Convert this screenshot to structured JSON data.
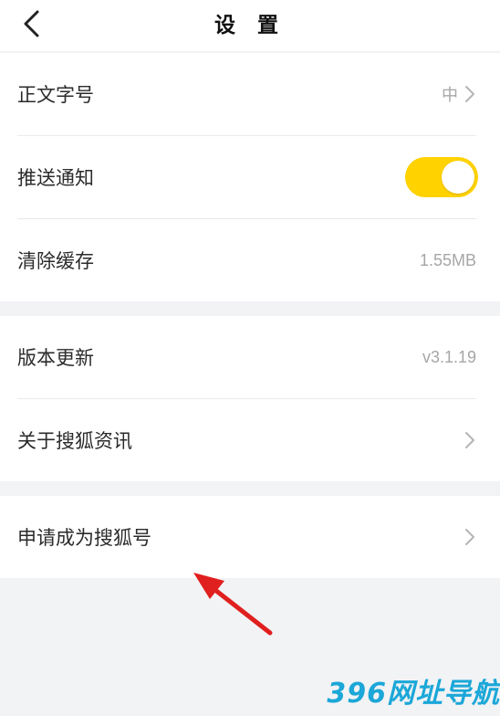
{
  "header": {
    "title": "设 置",
    "back_icon": "chevron-left-icon"
  },
  "group1": {
    "font_size": {
      "label": "正文字号",
      "value": "中"
    },
    "push": {
      "label": "推送通知",
      "enabled": true,
      "accent": "#ffd200"
    },
    "cache": {
      "label": "清除缓存",
      "value": "1.55MB"
    }
  },
  "group2": {
    "version": {
      "label": "版本更新",
      "value": "v3.1.19"
    },
    "about": {
      "label": "关于搜狐资讯"
    }
  },
  "group3": {
    "apply": {
      "label": "申请成为搜狐号"
    }
  },
  "watermark": {
    "text": "396网址导航"
  },
  "colors": {
    "background": "#f2f3f5",
    "arrow": "#e01f1f",
    "watermark": "#1ba7d8"
  }
}
